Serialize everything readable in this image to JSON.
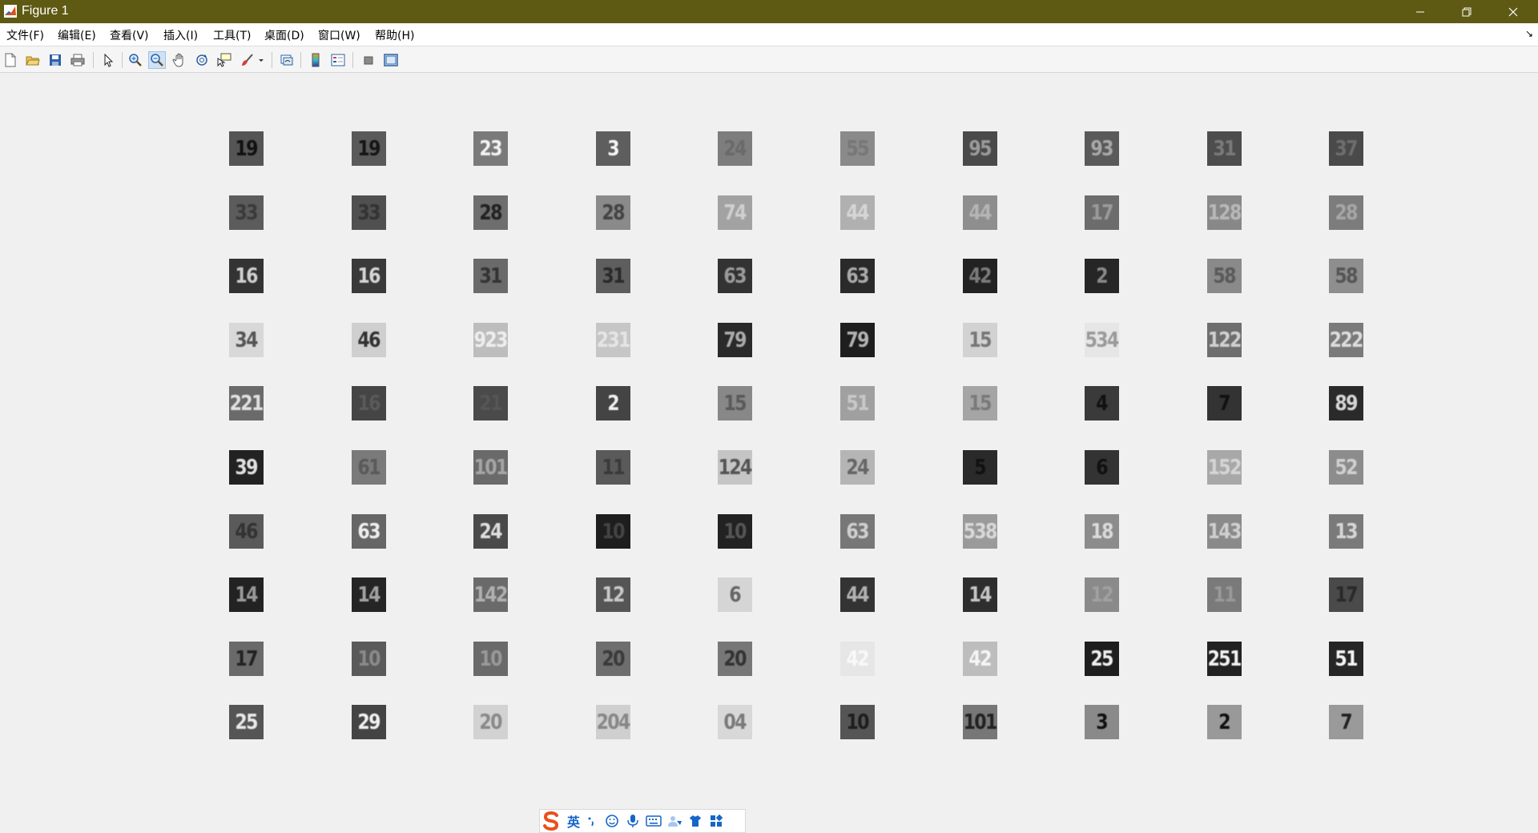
{
  "window": {
    "title": "Figure 1",
    "titlebar_color": "#5f5a13",
    "controls": [
      "minimize-icon",
      "restore-icon",
      "close-icon"
    ]
  },
  "menu": {
    "items": [
      {
        "label": "文件(F)"
      },
      {
        "label": "编辑(E)"
      },
      {
        "label": "查看(V)"
      },
      {
        "label": "插入(I)"
      },
      {
        "label": "工具(T)"
      },
      {
        "label": "桌面(D)"
      },
      {
        "label": "窗口(W)"
      },
      {
        "label": "帮助(H)"
      }
    ],
    "dock_arrow": "↘"
  },
  "toolbar": {
    "buttons": [
      {
        "icon": "new-figure-icon"
      },
      {
        "icon": "open-file-icon"
      },
      {
        "icon": "save-icon"
      },
      {
        "icon": "print-icon"
      },
      {
        "icon": "edit-plot-arrow-icon"
      },
      {
        "icon": "zoom-in-icon"
      },
      {
        "icon": "zoom-out-icon",
        "active": true
      },
      {
        "icon": "pan-hand-icon"
      },
      {
        "icon": "rotate-3d-icon"
      },
      {
        "icon": "data-cursor-icon"
      },
      {
        "icon": "brush-icon"
      },
      {
        "icon": "link-plot-icon"
      },
      {
        "icon": "insert-colorbar-icon"
      },
      {
        "icon": "insert-legend-icon"
      },
      {
        "icon": "hide-plot-tools-icon"
      },
      {
        "icon": "show-plot-tools-icon"
      }
    ]
  },
  "grid": {
    "rows": [
      [
        {
          "text": "19",
          "bg": "#555",
          "fg": "#111"
        },
        {
          "text": "19",
          "bg": "#5a5a5a",
          "fg": "#151515"
        },
        {
          "text": "23",
          "bg": "#7a7a7a",
          "fg": "#f2f2f2"
        },
        {
          "text": "3",
          "bg": "#5e5e5e",
          "fg": "#f5f5f5"
        },
        {
          "text": "24",
          "bg": "#7d7d7d",
          "fg": "#6a6a6a"
        },
        {
          "text": "55",
          "bg": "#8a8a8a",
          "fg": "#777"
        },
        {
          "text": "95",
          "bg": "#4a4a4a",
          "fg": "#9a9a9a"
        },
        {
          "text": "93",
          "bg": "#5a5a5a",
          "fg": "#a8a8a8"
        },
        {
          "text": "31",
          "bg": "#4d4d4d",
          "fg": "#7a7a7a"
        },
        {
          "text": "37",
          "bg": "#4a4a4a",
          "fg": "#6e6e6e"
        }
      ],
      [
        {
          "text": "33",
          "bg": "#5c5c5c",
          "fg": "#3a3a3a"
        },
        {
          "text": "33",
          "bg": "#505050",
          "fg": "#333"
        },
        {
          "text": "28",
          "bg": "#6e6e6e",
          "fg": "#222"
        },
        {
          "text": "28",
          "bg": "#8a8a8a",
          "fg": "#444"
        },
        {
          "text": "74",
          "bg": "#a2a2a2",
          "fg": "#cfcfcf"
        },
        {
          "text": "44",
          "bg": "#b0b0b0",
          "fg": "#d6d6d6"
        },
        {
          "text": "44",
          "bg": "#8e8e8e",
          "fg": "#b5b5b5"
        },
        {
          "text": "17",
          "bg": "#6c6c6c",
          "fg": "#9a9a9a"
        },
        {
          "text": "128",
          "bg": "#888",
          "fg": "#b8b8b8"
        },
        {
          "text": "28",
          "bg": "#7c7c7c",
          "fg": "#a6a6a6"
        }
      ],
      [
        {
          "text": "16",
          "bg": "#333",
          "fg": "#cfcfcf"
        },
        {
          "text": "16",
          "bg": "#3a3a3a",
          "fg": "#d5d5d5"
        },
        {
          "text": "31",
          "bg": "#6a6a6a",
          "fg": "#333"
        },
        {
          "text": "31",
          "bg": "#5e5e5e",
          "fg": "#2a2a2a"
        },
        {
          "text": "63",
          "bg": "#333",
          "fg": "#9a9a9a"
        },
        {
          "text": "63",
          "bg": "#2a2a2a",
          "fg": "#aaa"
        },
        {
          "text": "42",
          "bg": "#222",
          "fg": "#7a7a7a"
        },
        {
          "text": "2",
          "bg": "#262626",
          "fg": "#888"
        },
        {
          "text": "58",
          "bg": "#8a8a8a",
          "fg": "#5a5a5a"
        },
        {
          "text": "58",
          "bg": "#8e8e8e",
          "fg": "#555"
        }
      ],
      [
        {
          "text": "34",
          "bg": "#d8d8d8",
          "fg": "#555"
        },
        {
          "text": "46",
          "bg": "#cfcfcf",
          "fg": "#333"
        },
        {
          "text": "923",
          "bg": "#bdbdbd",
          "fg": "#eee"
        },
        {
          "text": "231",
          "bg": "#c6c6c6",
          "fg": "#e5e5e5"
        },
        {
          "text": "79",
          "bg": "#2a2a2a",
          "fg": "#aaa"
        },
        {
          "text": "79",
          "bg": "#1e1e1e",
          "fg": "#b2b2b2"
        },
        {
          "text": "15",
          "bg": "#d2d2d2",
          "fg": "#777"
        },
        {
          "text": "534",
          "bg": "#e6e6e6",
          "fg": "#9a9a9a"
        },
        {
          "text": "122",
          "bg": "#6e6e6e",
          "fg": "#d0d0d0"
        },
        {
          "text": "222",
          "bg": "#7a7a7a",
          "fg": "#dcdcdc"
        }
      ],
      [
        {
          "text": "221",
          "bg": "#6a6a6a",
          "fg": "#e0e0e0"
        },
        {
          "text": "16",
          "bg": "#454545",
          "fg": "#5a5a5a"
        },
        {
          "text": "21",
          "bg": "#4a4a4a",
          "fg": "#565656"
        },
        {
          "text": "2",
          "bg": "#444",
          "fg": "#f0f0f0"
        },
        {
          "text": "15",
          "bg": "#888",
          "fg": "#5a5a5a"
        },
        {
          "text": "51",
          "bg": "#a0a0a0",
          "fg": "#c8c8c8"
        },
        {
          "text": "15",
          "bg": "#a5a5a5",
          "fg": "#7a7a7a"
        },
        {
          "text": "4",
          "bg": "#3a3a3a",
          "fg": "#111"
        },
        {
          "text": "7",
          "bg": "#333",
          "fg": "#111"
        },
        {
          "text": "89",
          "bg": "#2a2a2a",
          "fg": "#d5d5d5"
        }
      ],
      [
        {
          "text": "39",
          "bg": "#222",
          "fg": "#e0e0e0"
        },
        {
          "text": "61",
          "bg": "#7a7a7a",
          "fg": "#5a5a5a"
        },
        {
          "text": "101",
          "bg": "#6a6a6a",
          "fg": "#a5a5a5"
        },
        {
          "text": "11",
          "bg": "#5a5a5a",
          "fg": "#3a3a3a"
        },
        {
          "text": "124",
          "bg": "#c5c5c5",
          "fg": "#555"
        },
        {
          "text": "24",
          "bg": "#b5b5b5",
          "fg": "#666"
        },
        {
          "text": "5",
          "bg": "#2a2a2a",
          "fg": "#111"
        },
        {
          "text": "6",
          "bg": "#333",
          "fg": "#111"
        },
        {
          "text": "152",
          "bg": "#a8a8a8",
          "fg": "#d5d5d5"
        },
        {
          "text": "52",
          "bg": "#8c8c8c",
          "fg": "#cfcfcf"
        }
      ],
      [
        {
          "text": "46",
          "bg": "#5a5a5a",
          "fg": "#333"
        },
        {
          "text": "63",
          "bg": "#666",
          "fg": "#eee"
        },
        {
          "text": "24",
          "bg": "#4a4a4a",
          "fg": "#ddd"
        },
        {
          "text": "10",
          "bg": "#1e1e1e",
          "fg": "#444"
        },
        {
          "text": "10",
          "bg": "#222",
          "fg": "#555"
        },
        {
          "text": "63",
          "bg": "#777",
          "fg": "#cfcfcf"
        },
        {
          "text": "538",
          "bg": "#9a9a9a",
          "fg": "#d8d8d8"
        },
        {
          "text": "18",
          "bg": "#8c8c8c",
          "fg": "#dadada"
        },
        {
          "text": "143",
          "bg": "#8a8a8a",
          "fg": "#cfcfcf"
        },
        {
          "text": "13",
          "bg": "#7a7a7a",
          "fg": "#d5d5d5"
        }
      ],
      [
        {
          "text": "14",
          "bg": "#222",
          "fg": "#999"
        },
        {
          "text": "14",
          "bg": "#252525",
          "fg": "#a2a2a2"
        },
        {
          "text": "142",
          "bg": "#6a6a6a",
          "fg": "#b0b0b0"
        },
        {
          "text": "12",
          "bg": "#555",
          "fg": "#c8c8c8"
        },
        {
          "text": "6",
          "bg": "#d5d5d5",
          "fg": "#666"
        },
        {
          "text": "44",
          "bg": "#333",
          "fg": "#b0b0b0"
        },
        {
          "text": "14",
          "bg": "#2e2e2e",
          "fg": "#c5c5c5"
        },
        {
          "text": "12",
          "bg": "#8a8a8a",
          "fg": "#a0a0a0"
        },
        {
          "text": "11",
          "bg": "#7a7a7a",
          "fg": "#999"
        },
        {
          "text": "17",
          "bg": "#4a4a4a",
          "fg": "#2a2a2a"
        }
      ],
      [
        {
          "text": "17",
          "bg": "#6a6a6a",
          "fg": "#222"
        },
        {
          "text": "10",
          "bg": "#5a5a5a",
          "fg": "#8a8a8a"
        },
        {
          "text": "10",
          "bg": "#6a6a6a",
          "fg": "#999"
        },
        {
          "text": "20",
          "bg": "#6e6e6e",
          "fg": "#3a3a3a"
        },
        {
          "text": "20",
          "bg": "#777",
          "fg": "#333"
        },
        {
          "text": "42",
          "bg": "#e6e6e6",
          "fg": "#f8f8f8"
        },
        {
          "text": "42",
          "bg": "#bdbdbd",
          "fg": "#f5f5f5"
        },
        {
          "text": "25",
          "bg": "#1e1e1e",
          "fg": "#eee"
        },
        {
          "text": "251",
          "bg": "#222",
          "fg": "#f2f2f2"
        },
        {
          "text": "51",
          "bg": "#262626",
          "fg": "#f5f5f5"
        }
      ],
      [
        {
          "text": "25",
          "bg": "#555",
          "fg": "#e8e8e8"
        },
        {
          "text": "29",
          "bg": "#444",
          "fg": "#f0f0f0"
        },
        {
          "text": "20",
          "bg": "#d2d2d2",
          "fg": "#8a8a8a"
        },
        {
          "text": "204",
          "bg": "#cfcfcf",
          "fg": "#888"
        },
        {
          "text": "04",
          "bg": "#d8d8d8",
          "fg": "#7a7a7a"
        },
        {
          "text": "10",
          "bg": "#555",
          "fg": "#1e1e1e"
        },
        {
          "text": "101",
          "bg": "#777",
          "fg": "#222"
        },
        {
          "text": "3",
          "bg": "#8a8a8a",
          "fg": "#111"
        },
        {
          "text": "2",
          "bg": "#999",
          "fg": "#111"
        },
        {
          "text": "7",
          "bg": "#9a9a9a",
          "fg": "#222"
        }
      ]
    ]
  },
  "ime": {
    "mode": "英",
    "icons": [
      "punctuation-icon",
      "emoji-icon",
      "microphone-icon",
      "keyboard-icon",
      "skin-tone-icon",
      "shirt-icon",
      "apps-grid-icon"
    ]
  }
}
